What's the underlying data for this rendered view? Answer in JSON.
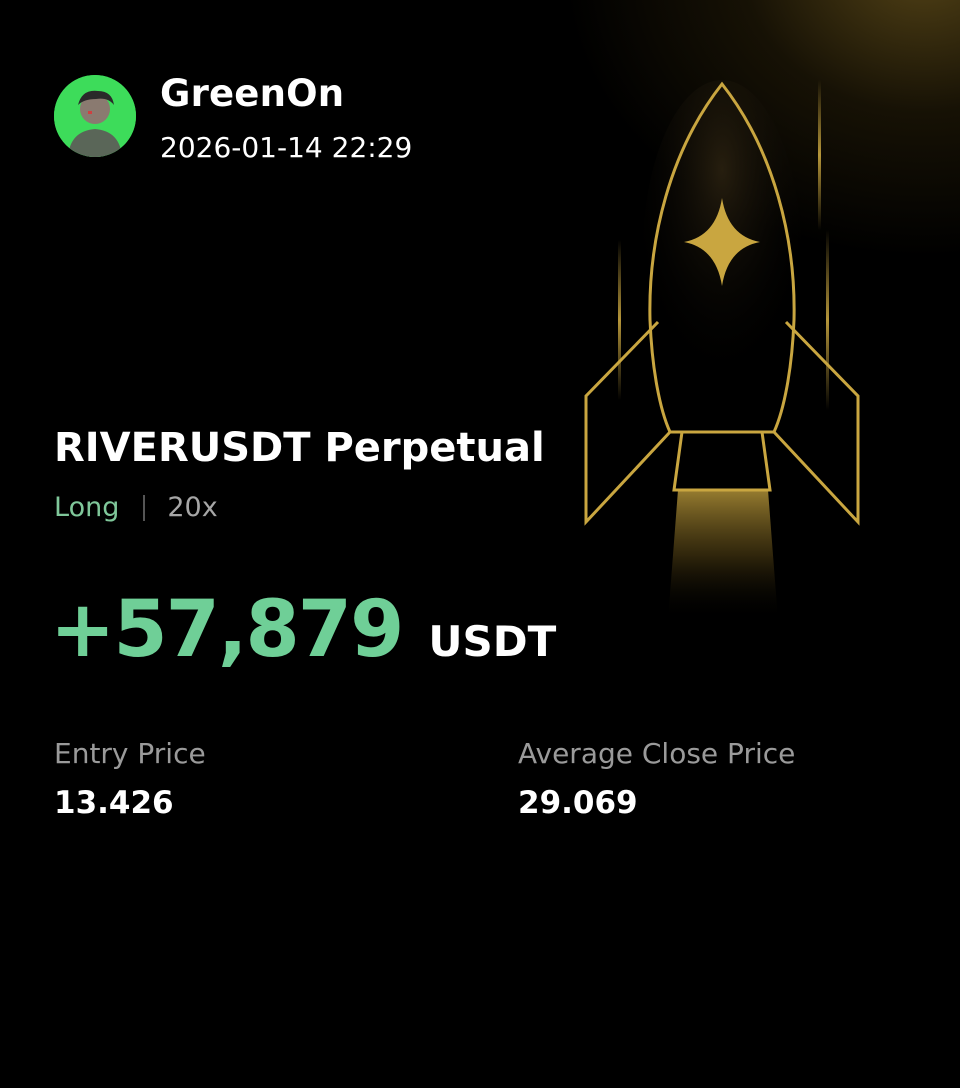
{
  "user": {
    "name": "GreenOn",
    "timestamp": "2026-01-14 22:29",
    "avatar_icon": "user-avatar-icon"
  },
  "position": {
    "pair": "RIVERUSDT Perpetual",
    "side": "Long",
    "leverage": "20x"
  },
  "pnl": {
    "value": "+57,879",
    "unit": "USDT"
  },
  "stats": {
    "entry_label": "Entry Price",
    "entry_value": "13.426",
    "close_label": "Average Close Price",
    "close_value": "29.069"
  },
  "decoration": {
    "icon": "rocket-icon"
  },
  "colors": {
    "background": "#000000",
    "profit": "#6fcf97",
    "side_long": "#7fc79a",
    "gold": "#c9a640",
    "muted": "#9a9a9a"
  }
}
